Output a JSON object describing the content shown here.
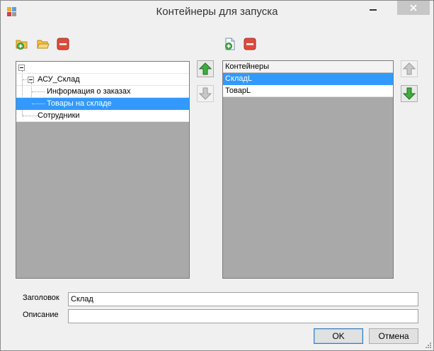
{
  "window": {
    "title": "Контейнеры для запуска"
  },
  "tree": {
    "nodes": [
      {
        "label": ""
      },
      {
        "label": "АСУ_Склад"
      },
      {
        "label": "Информация о заказах"
      },
      {
        "label": "Товары на складе",
        "selected": true
      },
      {
        "label": "Сотрудники"
      }
    ]
  },
  "containers": {
    "header": "Контейнеры",
    "rows": [
      {
        "label": "СкладL",
        "selected": true
      },
      {
        "label": "ТоварL"
      }
    ]
  },
  "form": {
    "title_label": "Заголовок",
    "title_value": "Склад",
    "description_label": "Описание",
    "description_value": ""
  },
  "buttons": {
    "ok": "OK",
    "cancel": "Отмена"
  },
  "icons": {
    "toolbar_left": [
      "add-folder-icon",
      "open-folder-icon",
      "remove-icon"
    ],
    "toolbar_right": [
      "add-document-icon",
      "remove-icon"
    ],
    "move_buttons": [
      "arrow-up-icon",
      "arrow-down-icon"
    ]
  },
  "colors": {
    "selection": "#3399ff",
    "panel_background": "#a9a9a9",
    "window_background": "#f0f0f0"
  }
}
